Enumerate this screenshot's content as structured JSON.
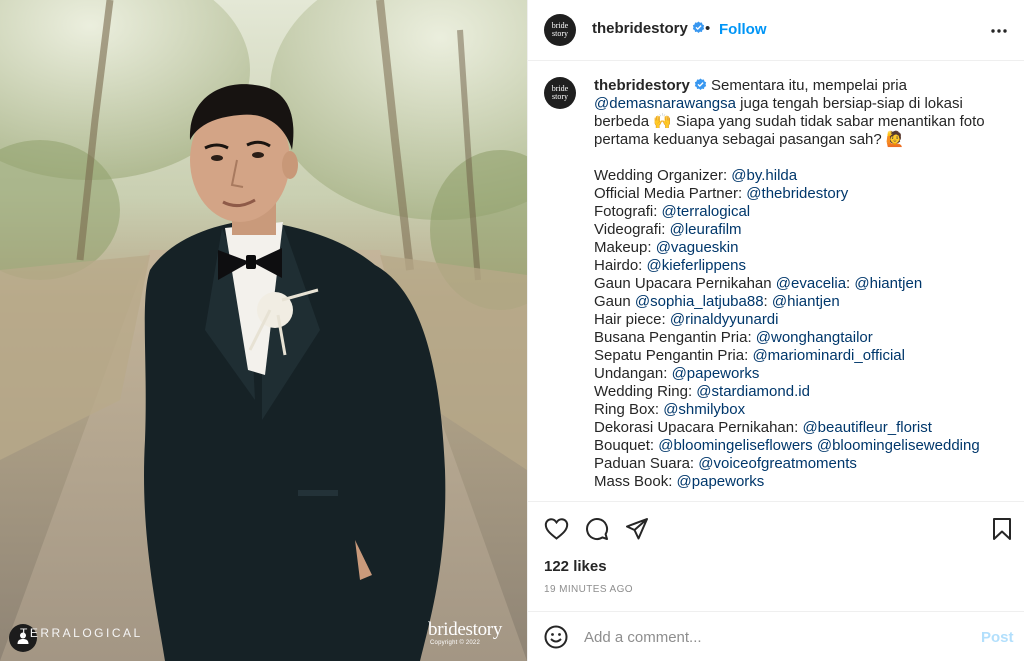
{
  "photo": {
    "watermark_left": "TERRALOGICAL",
    "watermark_brand": "bridestory",
    "watermark_copyright": "Copyright © 2022",
    "user_tag_icon": "person-icon"
  },
  "account": {
    "username": "thebridestory",
    "avatar_line1": "bride",
    "avatar_line2": "story",
    "verified_icon": "verified-badge-icon",
    "dot": "•",
    "follow_label": "Follow",
    "more_icon": "more-options-icon"
  },
  "caption": {
    "intro_lines": [
      {
        "pre": "",
        "mention": "",
        "post": " Sementara itu, mempelai pria"
      },
      {
        "pre": "",
        "mention": "@demasnarawangsa",
        "post": " juga tengah bersiap-siap di lokasi"
      },
      {
        "pre": "berbeda 🙌 Siapa yang sudah tidak sabar menantikan foto",
        "mention": "",
        "post": ""
      },
      {
        "pre": "pertama keduanya sebagai pasangan sah? 🙋",
        "mention": "",
        "post": ""
      }
    ],
    "credits": [
      {
        "label": "Wedding Organizer: ",
        "m1": "@by.hilda",
        "sep": "",
        "m2": ""
      },
      {
        "label": "Official Media Partner: ",
        "m1": "@thebridestory",
        "sep": "",
        "m2": ""
      },
      {
        "label": "Fotografi: ",
        "m1": "@terralogical",
        "sep": "",
        "m2": ""
      },
      {
        "label": "Videografi: ",
        "m1": "@leurafilm",
        "sep": "",
        "m2": ""
      },
      {
        "label": "Makeup: ",
        "m1": "@vagueskin",
        "sep": "",
        "m2": ""
      },
      {
        "label": "Hairdo: ",
        "m1": "@kieferlippens",
        "sep": "",
        "m2": ""
      },
      {
        "label": "Gaun Upacara Pernikahan ",
        "m1": "@evacelia",
        "sep": ": ",
        "m2": "@hiantjen"
      },
      {
        "label": "Gaun ",
        "m1": "@sophia_latjuba88",
        "sep": ": ",
        "m2": "@hiantjen"
      },
      {
        "label": "Hair piece: ",
        "m1": "@rinaldyyunardi",
        "sep": "",
        "m2": ""
      },
      {
        "label": "Busana Pengantin Pria: ",
        "m1": "@wonghangtailor",
        "sep": "",
        "m2": ""
      },
      {
        "label": "Sepatu Pengantin Pria: ",
        "m1": "@mariominardi_official",
        "sep": "",
        "m2": ""
      },
      {
        "label": "Undangan: ",
        "m1": "@papeworks",
        "sep": "",
        "m2": ""
      },
      {
        "label": "Wedding Ring: ",
        "m1": "@stardiamond.id",
        "sep": "",
        "m2": ""
      },
      {
        "label": "Ring Box: ",
        "m1": "@shmilybox",
        "sep": "",
        "m2": ""
      },
      {
        "label": "Dekorasi Upacara Pernikahan: ",
        "m1": "@beautifleur_florist",
        "sep": "",
        "m2": ""
      },
      {
        "label": "Bouquet: ",
        "m1": "@bloomingeliseflowers",
        "sep": " ",
        "m2": "@bloomingelisewedding"
      },
      {
        "label": "Paduan Suara: ",
        "m1": "@voiceofgreatmoments",
        "sep": "",
        "m2": ""
      },
      {
        "label": "Mass Book: ",
        "m1": "@papeworks",
        "sep": "",
        "m2": ""
      }
    ]
  },
  "actions": {
    "like_icon": "heart-icon",
    "comment_icon": "comment-icon",
    "share_icon": "share-icon",
    "save_icon": "bookmark-icon",
    "likes": "122 likes",
    "timestamp": "19 MINUTES AGO"
  },
  "comment": {
    "emoji_icon": "emoji-icon",
    "placeholder": "Add a comment...",
    "post_label": "Post"
  },
  "colors": {
    "accent": "#0095f6",
    "mention": "#00376b",
    "post_disabled": "#b2dffc",
    "muted": "#8e8e8e"
  }
}
